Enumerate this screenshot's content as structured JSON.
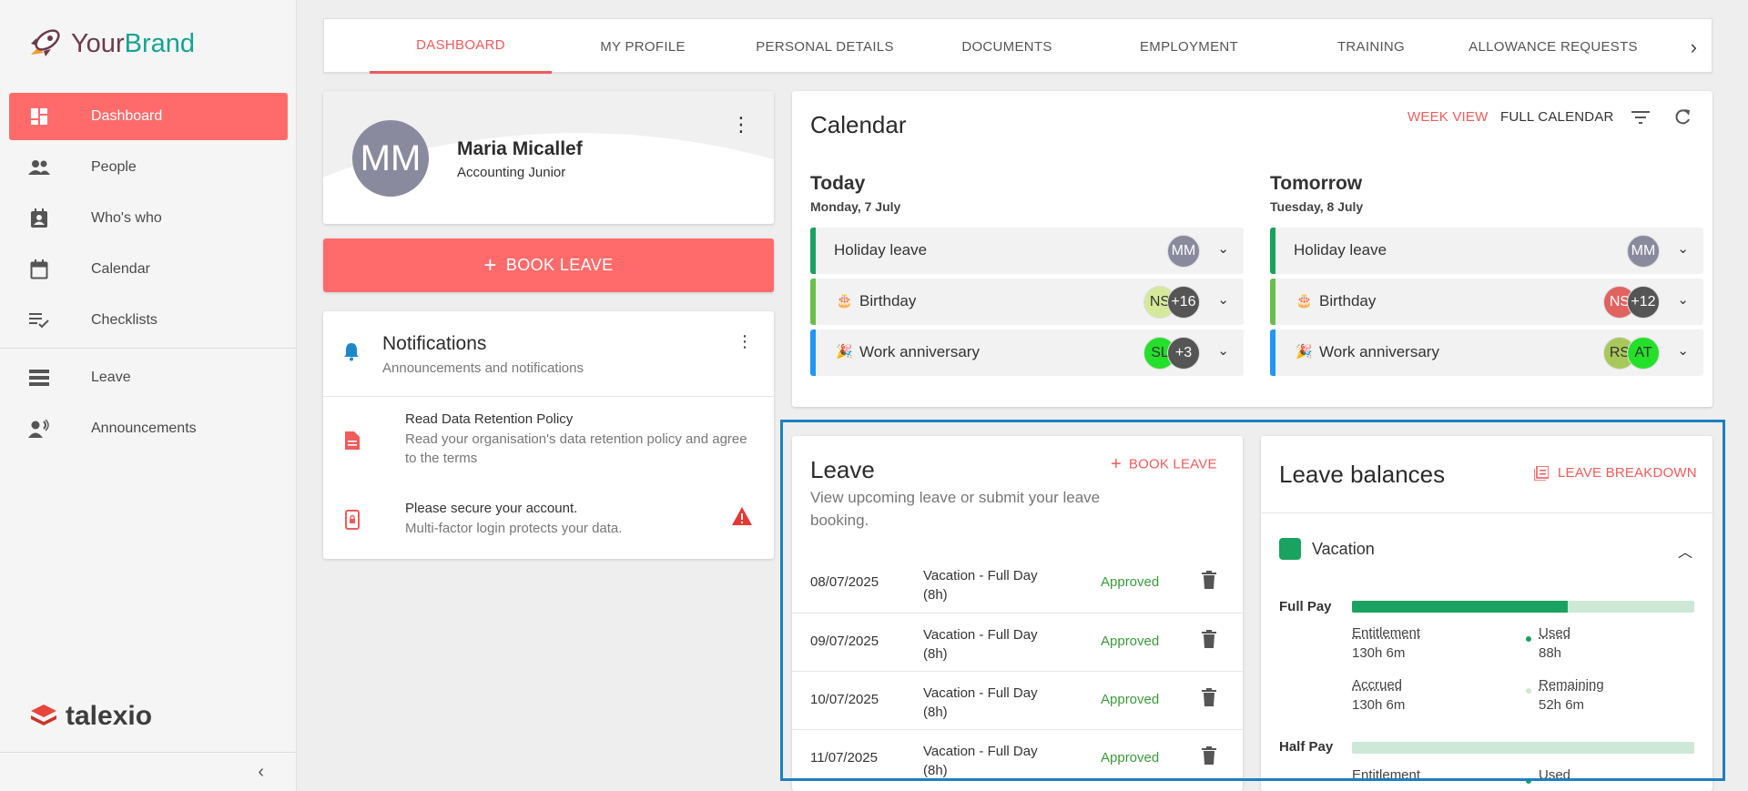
{
  "brand": {
    "your": "Your",
    "brand": "Brand",
    "footer_logo": "talexio"
  },
  "sidebar": {
    "items": [
      {
        "label": "Dashboard",
        "icon": "dashboard-icon",
        "active": true
      },
      {
        "label": "People",
        "icon": "people-icon"
      },
      {
        "label": "Who's who",
        "icon": "contact-card-icon"
      },
      {
        "label": "Calendar",
        "icon": "calendar-icon"
      },
      {
        "label": "Checklists",
        "icon": "checklist-icon"
      },
      {
        "label": "Leave",
        "icon": "leave-icon"
      },
      {
        "label": "Announcements",
        "icon": "announcements-icon"
      }
    ]
  },
  "tabs": [
    "DASHBOARD",
    "MY PROFILE",
    "PERSONAL DETAILS",
    "DOCUMENTS",
    "EMPLOYMENT",
    "TRAINING",
    "ALLOWANCE REQUESTS"
  ],
  "profile": {
    "initials": "MM",
    "name": "Maria Micallef",
    "role": "Accounting Junior"
  },
  "book_leave_button": "BOOK LEAVE",
  "notifications": {
    "title": "Notifications",
    "subtitle": "Announcements and notifications",
    "items": [
      {
        "title": "Read Data Retention Policy",
        "body": "Read your organisation's data retention policy and agree to the terms"
      },
      {
        "title": "Please secure your account.",
        "body": "Multi-factor login protects your data."
      }
    ]
  },
  "calendar": {
    "title": "Calendar",
    "week_view": "WEEK VIEW",
    "full_calendar": "FULL CALENDAR",
    "today": {
      "heading": "Today",
      "date": "Monday, 7 July",
      "events": [
        {
          "label": "Holiday leave",
          "avatars": [
            "MM"
          ],
          "color": "#1aa260"
        },
        {
          "label": "Birthday",
          "avatars": [
            "NS",
            "+16"
          ],
          "color": "#6abf4b"
        },
        {
          "label": "Work anniversary",
          "avatars": [
            "SL",
            "+3"
          ],
          "color": "#2196f3"
        }
      ]
    },
    "tomorrow": {
      "heading": "Tomorrow",
      "date": "Tuesday, 8 July",
      "events": [
        {
          "label": "Holiday leave",
          "avatars": [
            "MM"
          ],
          "color": "#1aa260"
        },
        {
          "label": "Birthday",
          "avatars": [
            "NS",
            "+12"
          ],
          "color": "#6abf4b"
        },
        {
          "label": "Work anniversary",
          "avatars": [
            "RS",
            "AT"
          ],
          "color": "#2196f3"
        }
      ]
    }
  },
  "leave": {
    "title": "Leave",
    "subtitle": "View upcoming leave or submit your leave booking.",
    "book": "BOOK LEAVE",
    "rows": [
      {
        "date": "08/07/2025",
        "type": "Vacation - Full Day (8h)",
        "status": "Approved"
      },
      {
        "date": "09/07/2025",
        "type": "Vacation - Full Day (8h)",
        "status": "Approved"
      },
      {
        "date": "10/07/2025",
        "type": "Vacation - Full Day (8h)",
        "status": "Approved"
      },
      {
        "date": "11/07/2025",
        "type": "Vacation - Full Day (8h)",
        "status": "Approved"
      }
    ]
  },
  "balances": {
    "title": "Leave balances",
    "breakdown": "LEAVE BREAKDOWN",
    "vacation": "Vacation",
    "full_pay": {
      "label": "Full Pay",
      "used_fraction": 0.63,
      "entitlement_label": "Entitlement",
      "entitlement": "130h 6m",
      "used_label": "Used",
      "used": "88h",
      "accrued_label": "Accrued",
      "accrued": "130h 6m",
      "remaining_label": "Remaining",
      "remaining": "52h 6m"
    },
    "half_pay": {
      "label": "Half Pay",
      "used_fraction": 0,
      "entitlement_label": "Entitlement",
      "used_label": "Used"
    }
  },
  "colors": {
    "accent": "#ff6b6b",
    "accent_text": "#ef5b5b",
    "green": "#1aa260",
    "highlight": "#1f7fc1"
  }
}
